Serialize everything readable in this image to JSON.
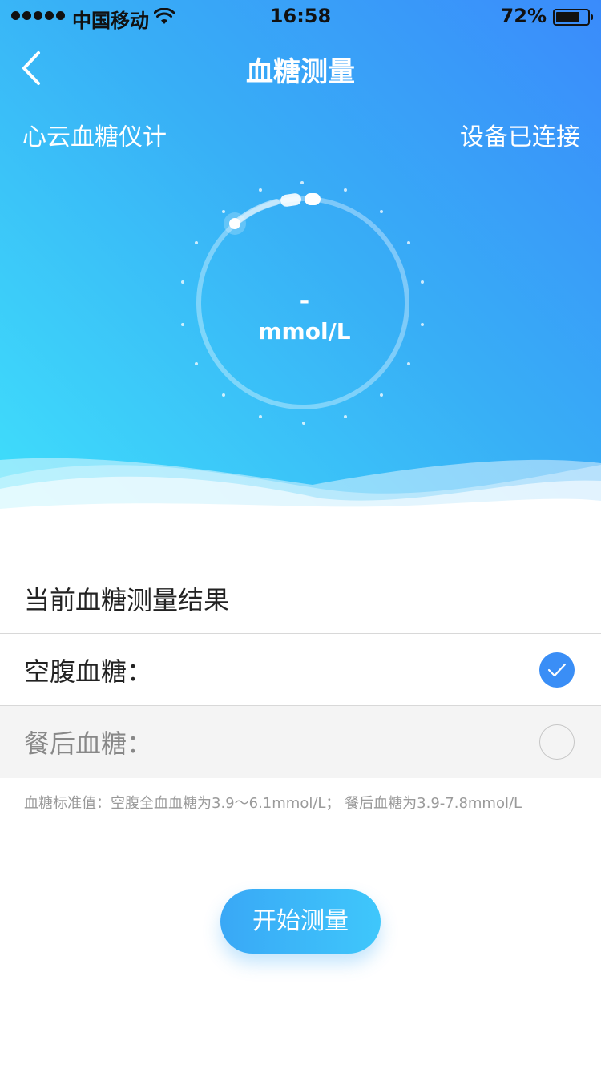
{
  "status_bar": {
    "carrier": "中国移动",
    "time": "16:58",
    "battery_percent": "72%",
    "battery_level": 0.72,
    "signal_bars": 5
  },
  "nav": {
    "title": "血糖测量",
    "back_icon": "chevron-left-icon"
  },
  "device": {
    "name": "心云血糖仪计",
    "status": "设备已连接"
  },
  "gauge": {
    "value": "-",
    "unit": "mmol/L"
  },
  "results": {
    "section_title": "当前血糖测量结果",
    "options": [
      {
        "label": "空腹血糖：",
        "checked": true
      },
      {
        "label": "餐后血糖：",
        "checked": false
      }
    ]
  },
  "note": "血糖标准值：空腹全血血糖为3.9～6.1mmol/L；  餐后血糖为3.9-7.8mmol/L",
  "start_button": "开始测量",
  "colors": {
    "accent": "#3a8ef6",
    "gradient_start": "#3fe0fb",
    "gradient_end": "#3a8bfb"
  }
}
